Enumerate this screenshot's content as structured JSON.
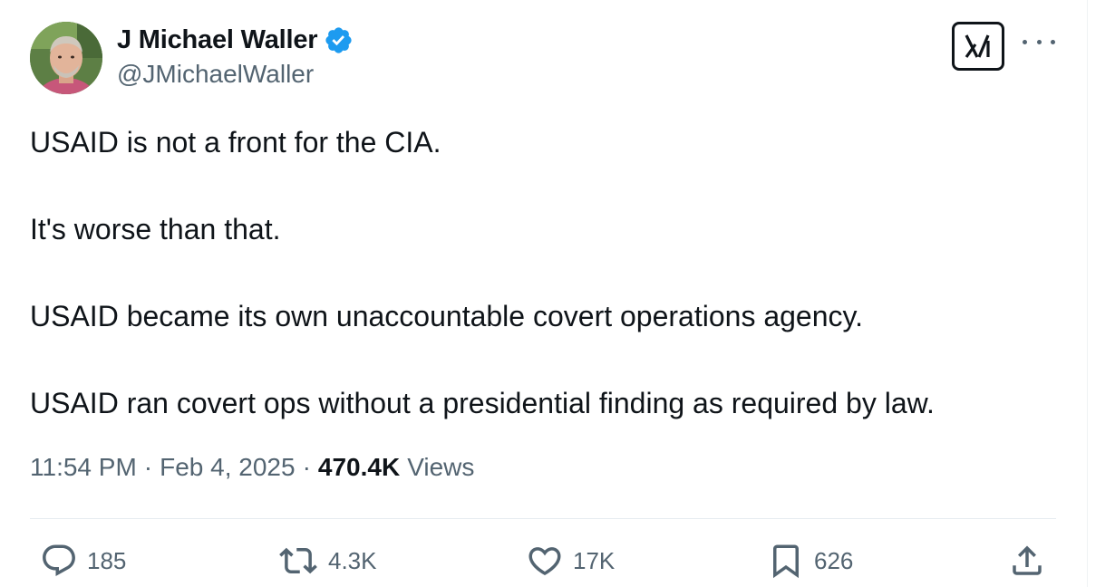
{
  "author": {
    "display_name": "J Michael Waller",
    "handle": "@JMichaelWaller",
    "verified_color": "#1d9bf0"
  },
  "header_buttons": {
    "grok_icon": "grok-icon",
    "more_icon": "more-icon"
  },
  "tweet": {
    "paragraphs": [
      "USAID is not a front for the CIA.",
      "It's worse than that.",
      "USAID became its own unaccountable covert operations agency.",
      "USAID ran covert ops without a presidential finding as required by law."
    ]
  },
  "meta": {
    "time": "11:54 PM",
    "separator": "·",
    "date": "Feb 4, 2025",
    "views_count": "470.4K",
    "views_label": "Views"
  },
  "actions": {
    "replies": "185",
    "reposts": "4.3K",
    "likes": "17K",
    "bookmarks": "626"
  },
  "colors": {
    "text": "#0f1419",
    "secondary": "#536471",
    "accent": "#1d9bf0"
  }
}
